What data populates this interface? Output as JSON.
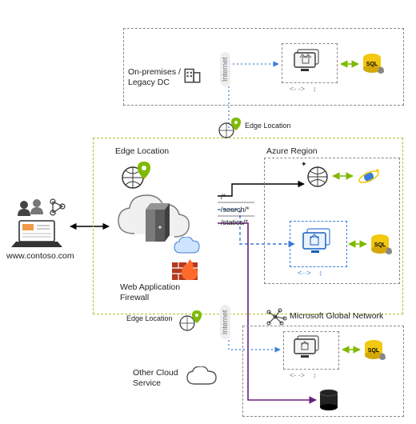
{
  "chart_data": {
    "type": "architecture-diagram",
    "nodes": [
      {
        "id": "client",
        "label": "www.contoso.com",
        "kind": "client-laptop-users",
        "region": "internet"
      },
      {
        "id": "edge-main",
        "label": "Edge Location",
        "kind": "azure-front-door",
        "region": "edge"
      },
      {
        "id": "waf",
        "label": "Web Application Firewall",
        "kind": "firewall",
        "region": "edge"
      },
      {
        "id": "edge-top",
        "label": "Edge Location",
        "kind": "edge-pin",
        "region": "edge"
      },
      {
        "id": "edge-bottom",
        "label": "Edge Location",
        "kind": "edge-pin",
        "region": "edge"
      },
      {
        "id": "onprem-building",
        "label": "On-premises / Legacy DC",
        "kind": "datacenter-building",
        "region": "on-prem"
      },
      {
        "id": "onprem-vms",
        "label": "",
        "kind": "vm-pool",
        "region": "on-prem"
      },
      {
        "id": "onprem-sql",
        "label": "",
        "kind": "sql-database",
        "region": "on-prem"
      },
      {
        "id": "azure-region",
        "label": "Azure Region",
        "kind": "container",
        "region": "azure"
      },
      {
        "id": "azure-static",
        "label": "",
        "kind": "static-web-app",
        "region": "azure"
      },
      {
        "id": "azure-cosmos",
        "label": "",
        "kind": "cosmos-db",
        "region": "azure"
      },
      {
        "id": "azure-vms",
        "label": "",
        "kind": "vm-pool",
        "region": "azure"
      },
      {
        "id": "azure-sql",
        "label": "",
        "kind": "sql-database",
        "region": "azure"
      },
      {
        "id": "msgn",
        "label": "Microsoft Global Network",
        "kind": "network-mesh",
        "region": "backbone"
      },
      {
        "id": "othercloud",
        "label": "Other Cloud Service",
        "kind": "cloud",
        "region": "other-cloud"
      },
      {
        "id": "other-vms",
        "label": "",
        "kind": "vm-pool",
        "region": "other-cloud"
      },
      {
        "id": "other-sql",
        "label": "",
        "kind": "sql-database",
        "region": "other-cloud"
      },
      {
        "id": "other-db",
        "label": "",
        "kind": "generic-database",
        "region": "other-cloud"
      }
    ],
    "edges": [
      {
        "from": "client",
        "to": "edge-main",
        "style": "solid-black",
        "bidirectional": true
      },
      {
        "from": "edge-main",
        "to": "azure-static",
        "path_label": "/*",
        "style": "solid-black"
      },
      {
        "from": "edge-main",
        "to": "azure-vms",
        "path_label": "/search/*",
        "style": "dashed-blue"
      },
      {
        "from": "edge-main",
        "to": "other-db",
        "path_label": "/statics/*",
        "style": "solid-purple"
      },
      {
        "from": "edge-top",
        "to": "onprem-vms",
        "style": "dotted-blue",
        "via": "Internet"
      },
      {
        "from": "edge-bottom",
        "to": "other-vms",
        "style": "dotted-blue",
        "via": "Internet"
      },
      {
        "from": "onprem-vms",
        "to": "onprem-sql",
        "style": "solid-green",
        "bidirectional": true
      },
      {
        "from": "azure-static",
        "to": "azure-cosmos",
        "style": "solid-green",
        "bidirectional": true
      },
      {
        "from": "azure-vms",
        "to": "azure-sql",
        "style": "solid-green",
        "bidirectional": true
      },
      {
        "from": "other-vms",
        "to": "other-sql",
        "style": "solid-green",
        "bidirectional": true
      }
    ],
    "path_labels": [
      "/*",
      "/search/*",
      "/statics/*"
    ],
    "internet_labels": [
      "Internet",
      "Internet"
    ]
  },
  "labels": {
    "client_url": "www.contoso.com",
    "edge_location": "Edge Location",
    "waf": "Web Application Firewall",
    "onprem": "On-premises /\nLegacy DC",
    "azure_region": "Azure Region",
    "msgn": "Microsoft Global Network",
    "other_cloud": "Other Cloud\nService",
    "edge_top": "Edge Location",
    "edge_bottom": "Edge Location",
    "route_root": "/*",
    "route_search": "/search/*",
    "route_statics": "/statics/*",
    "internet": "Internet"
  },
  "colors": {
    "edge_border": "#a9c62d",
    "azure_border": "#3b7dd8",
    "onprem_border": "#888888",
    "arrow_green": "#7fba00",
    "arrow_blue": "#3b7dd8",
    "arrow_purple": "#68217a",
    "arrow_black": "#000000",
    "firewall": "#e34c26",
    "sql": "#f2c811"
  }
}
